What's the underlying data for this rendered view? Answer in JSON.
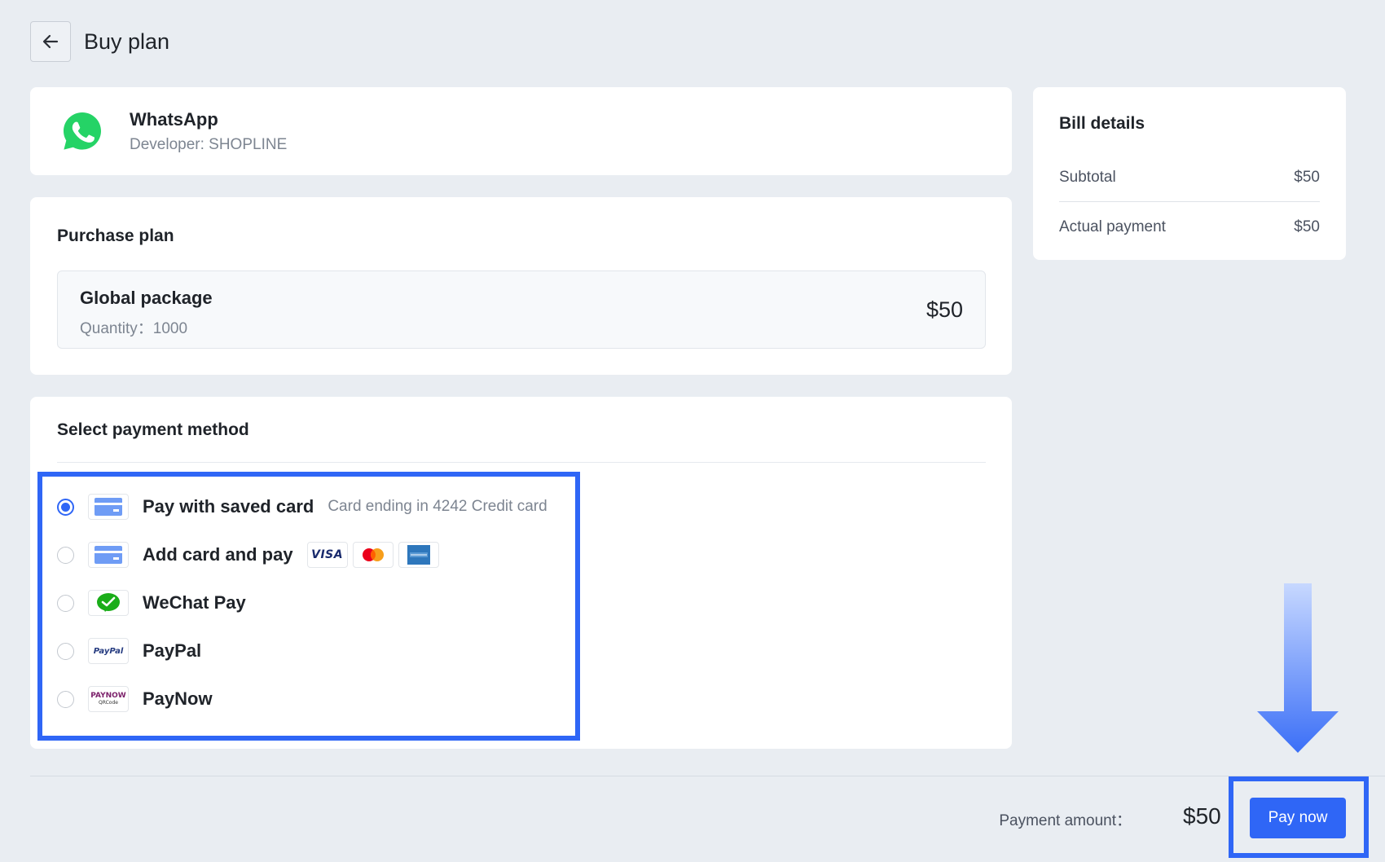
{
  "header": {
    "title": "Buy plan"
  },
  "app": {
    "name": "WhatsApp",
    "developer": "Developer: SHOPLINE",
    "brand_color": "#25d366"
  },
  "purchase": {
    "title": "Purchase plan",
    "plan_name": "Global package",
    "quantity": "Quantity：1000",
    "price": "$50"
  },
  "payment": {
    "title": "Select payment method",
    "selected": "Pay with saved card",
    "methods": [
      {
        "label": "Pay with saved card",
        "note": "Card ending in 4242 Credit card",
        "icon": "credit-card-icon",
        "checked": true
      },
      {
        "label": "Add card and pay",
        "icon": "credit-card-icon",
        "brands": [
          "VISA",
          "Mastercard",
          "American Express"
        ],
        "checked": false
      },
      {
        "label": "WeChat Pay",
        "icon": "wechat-pay-icon",
        "checked": false
      },
      {
        "label": "PayPal",
        "icon": "paypal-icon",
        "checked": false
      },
      {
        "label": "PayNow",
        "icon": "paynow-icon",
        "checked": false
      }
    ],
    "brand_visa_text": "VISA",
    "paypal_logo_text": "PayPal",
    "paynow_logo_text": "PAYNOW",
    "paynow_logo_sub": "QRCode"
  },
  "bill": {
    "title": "Bill details",
    "subtotal_label": "Subtotal",
    "subtotal_value": "$50",
    "actual_label": "Actual payment",
    "actual_value": "$50"
  },
  "footer": {
    "amount_label": "Payment amount：",
    "amount_value": "$50",
    "pay_button": "Pay now"
  },
  "colors": {
    "accent": "#2f66f6",
    "background": "#e9edf2"
  }
}
